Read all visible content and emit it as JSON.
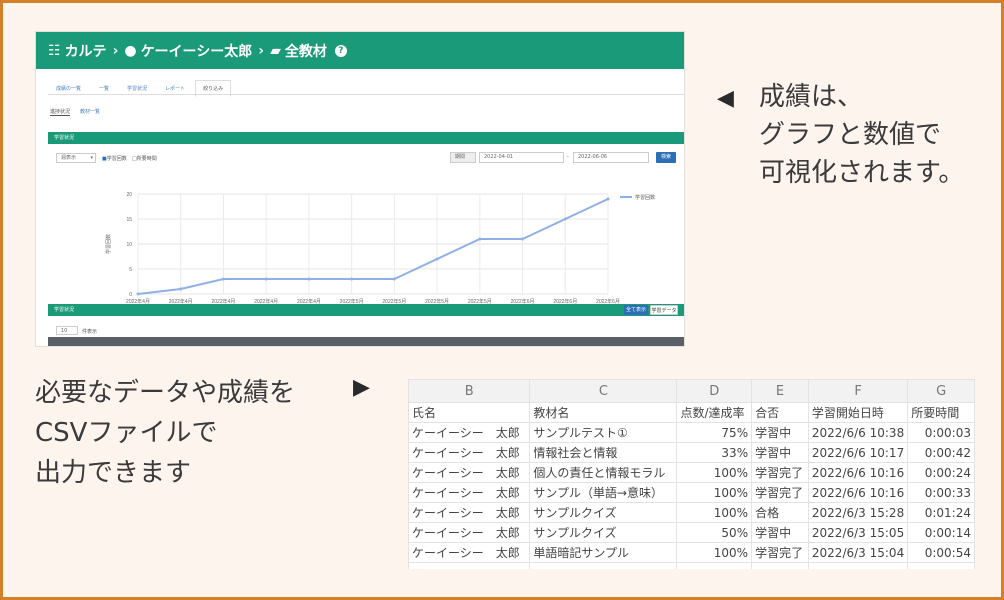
{
  "app": {
    "breadcrumb": [
      "カルテ",
      "ケーイーシー太郎",
      "全教材"
    ],
    "tabs": [
      "成績の一覧",
      "一覧",
      "学習状況",
      "レポート",
      "絞り込み"
    ],
    "subtabs": [
      "進捗状況",
      "教材一覧"
    ],
    "panel1_title": "学習状況",
    "select_value": "週表示",
    "legend": [
      "学習回数",
      "所要時間"
    ],
    "period_label": "期間",
    "date_from": "2022-04-01",
    "date_to": "2022-06-06",
    "search_button": "検索",
    "panel2_title": "学習状況",
    "panel2_btn1": "全て表示",
    "panel2_btn2": "学習データ",
    "page_size": "10",
    "page_size_unit": "件表示"
  },
  "chart_data": {
    "type": "line",
    "title": "",
    "xlabel": "",
    "ylabel": "学習回数",
    "ylim": [
      0,
      20
    ],
    "yticks": [
      0,
      5,
      10,
      15,
      20
    ],
    "categories": [
      "2022年4月",
      "2022年4月",
      "2022年4月",
      "2022年4月",
      "2022年4月",
      "2022年5月",
      "2022年5月",
      "2022年5月",
      "2022年5月",
      "2022年6月",
      "2022年6月",
      "2022年6月"
    ],
    "series": [
      {
        "name": "学習回数",
        "values": [
          0,
          1,
          3,
          3,
          3,
          3,
          3,
          7,
          11,
          11,
          15,
          19
        ]
      }
    ]
  },
  "captions": {
    "right": [
      "成績は、",
      "グラフと数値で",
      "可視化されます。"
    ],
    "left": [
      "必要なデータや成績を",
      "CSVファイルで",
      "出力できます"
    ]
  },
  "sheet": {
    "columns": [
      "B",
      "C",
      "D",
      "E",
      "F",
      "G"
    ],
    "headers": [
      "氏名",
      "教材名",
      "点数/達成率",
      "合否",
      "学習開始日時",
      "所要時間"
    ],
    "rows": [
      [
        "ケーイーシー　太郎",
        "サンプルテスト①",
        "75%",
        "学習中",
        "2022/6/6 10:38",
        "0:00:03"
      ],
      [
        "ケーイーシー　太郎",
        "情報社会と情報",
        "33%",
        "学習中",
        "2022/6/6 10:17",
        "0:00:42"
      ],
      [
        "ケーイーシー　太郎",
        "個人の責任と情報モラル",
        "100%",
        "学習完了",
        "2022/6/6 10:16",
        "0:00:24"
      ],
      [
        "ケーイーシー　太郎",
        "サンプル（単語→意味）",
        "100%",
        "学習完了",
        "2022/6/6 10:16",
        "0:00:33"
      ],
      [
        "ケーイーシー　太郎",
        "サンプルクイズ",
        "100%",
        "合格",
        "2022/6/3 15:28",
        "0:01:24"
      ],
      [
        "ケーイーシー　太郎",
        "サンプルクイズ",
        "50%",
        "学習中",
        "2022/6/3 15:05",
        "0:00:14"
      ],
      [
        "ケーイーシー　太郎",
        "単語暗記サンプル",
        "100%",
        "学習完了",
        "2022/6/3 15:04",
        "0:00:54"
      ]
    ]
  },
  "colors": {
    "frame": "#d2802a",
    "background": "#fdf4ee",
    "header": "#1a9a78",
    "line": "#8fb0e6"
  }
}
